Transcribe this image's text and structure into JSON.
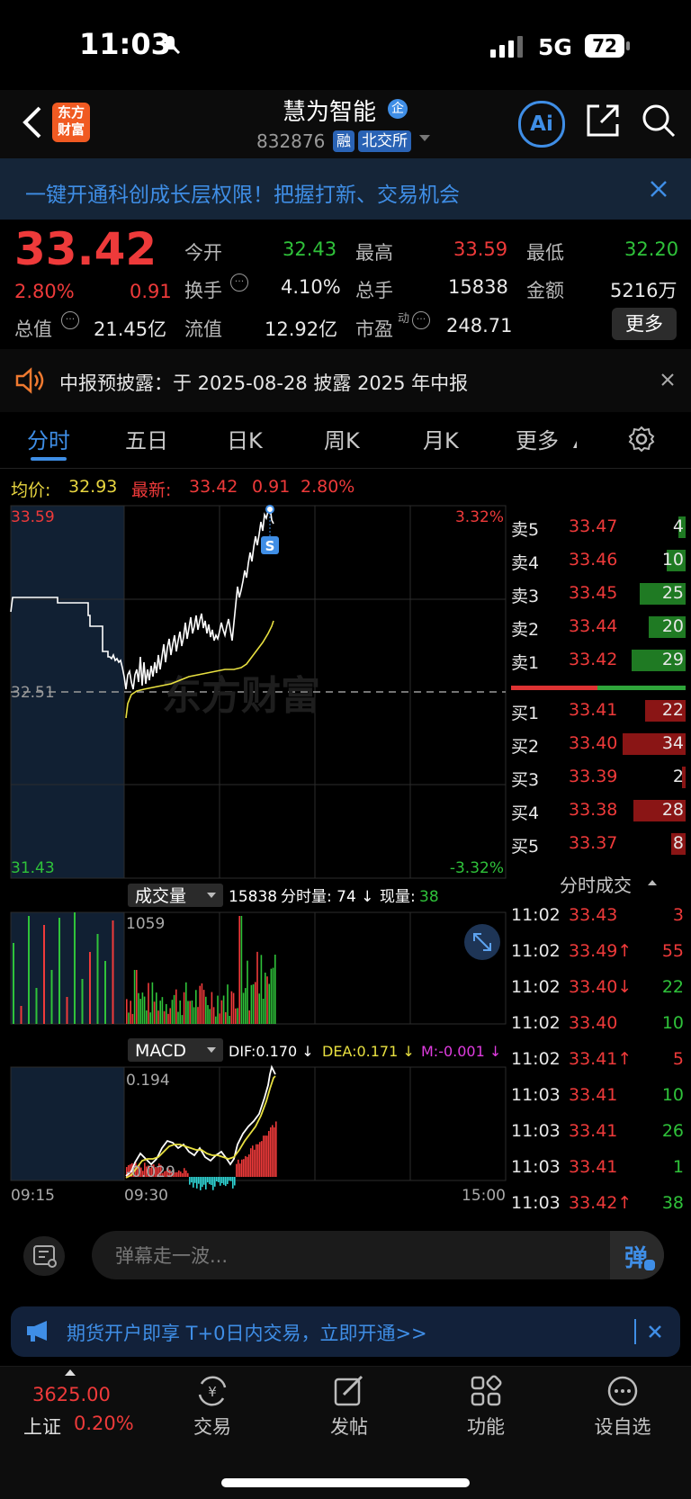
{
  "status_bar": {
    "time": "11:03",
    "network": "5G",
    "battery": "72"
  },
  "header": {
    "brand_logo": "东方\n财富",
    "stock_name": "慧为智能",
    "badge_qi": "企",
    "stock_code": "832876",
    "tag_rong": "融",
    "tag_exchange": "北交所",
    "ai_label": "Ai"
  },
  "banner": {
    "text": "一键开通科创成长层权限！把握打新、交易机会"
  },
  "quote": {
    "price": "33.42",
    "change_pct": "2.80%",
    "change": "0.91",
    "open_label": "今开",
    "open": "32.43",
    "high_label": "最高",
    "high": "33.59",
    "low_label": "最低",
    "low": "32.20",
    "turnover_label": "换手",
    "turnover": "4.10%",
    "volume_label": "总手",
    "volume": "15838",
    "amount_label": "金额",
    "amount": "5216万",
    "mktcap_label": "总值",
    "mktcap": "21.45亿",
    "float_label": "流值",
    "float": "12.92亿",
    "pe_label": "市盈",
    "pe_sup": "动",
    "pe": "248.71",
    "more": "更多"
  },
  "notice": {
    "text": "中报预披露：于 2025-08-28 披露 2025 年中报"
  },
  "tabs": [
    "分时",
    "五日",
    "日K",
    "周K",
    "月K",
    "更多"
  ],
  "chart_header": {
    "avg_label": "均价:",
    "avg": "32.93",
    "latest_label": "最新:",
    "latest": "33.42",
    "latest_change": "0.91",
    "latest_pct": "2.80%"
  },
  "price_chart": {
    "y_top": "33.59",
    "y_mid": "32.51",
    "y_bottom": "31.43",
    "pct_top": "3.32%",
    "pct_bottom": "-3.32%",
    "marker": "S",
    "watermark": "东方财富"
  },
  "volume_panel": {
    "label": "成交量",
    "total": "15838",
    "minute_label": "分时量: 74 ↓",
    "now_label": "现量:",
    "now": "38",
    "ytick": "1059"
  },
  "macd_panel": {
    "label": "MACD",
    "dif": "DIF:0.170 ↓",
    "dea": "DEA:0.171 ↓",
    "m": "M:-0.001 ↓",
    "ytop": "0.194",
    "ybottom": "-0.029"
  },
  "x_axis": {
    "start": "09:15",
    "open": "09:30",
    "end": "15:00"
  },
  "order_book": {
    "asks": [
      {
        "label": "卖5",
        "price": "33.47",
        "qty": "4"
      },
      {
        "label": "卖4",
        "price": "33.46",
        "qty": "10"
      },
      {
        "label": "卖3",
        "price": "33.45",
        "qty": "25"
      },
      {
        "label": "卖2",
        "price": "33.44",
        "qty": "20"
      },
      {
        "label": "卖1",
        "price": "33.42",
        "qty": "29"
      }
    ],
    "bids": [
      {
        "label": "买1",
        "price": "33.41",
        "qty": "22"
      },
      {
        "label": "买2",
        "price": "33.40",
        "qty": "34"
      },
      {
        "label": "买3",
        "price": "33.39",
        "qty": "2"
      },
      {
        "label": "买4",
        "price": "33.38",
        "qty": "28"
      },
      {
        "label": "买5",
        "price": "33.37",
        "qty": "8"
      }
    ]
  },
  "ticks_title": "分时成交",
  "ticks": [
    {
      "time": "11:02",
      "price": "33.43",
      "qty": "3",
      "qcolor": "red"
    },
    {
      "time": "11:02",
      "price": "33.49↑",
      "qty": "55",
      "qcolor": "red"
    },
    {
      "time": "11:02",
      "price": "33.40↓",
      "qty": "22",
      "qcolor": "green"
    },
    {
      "time": "11:02",
      "price": "33.40",
      "qty": "10",
      "qcolor": "green"
    },
    {
      "time": "11:02",
      "price": "33.41↑",
      "qty": "5",
      "qcolor": "red"
    },
    {
      "time": "11:03",
      "price": "33.41",
      "qty": "10",
      "qcolor": "green"
    },
    {
      "time": "11:03",
      "price": "33.41",
      "qty": "26",
      "qcolor": "green"
    },
    {
      "time": "11:03",
      "price": "33.41",
      "qty": "1",
      "qcolor": "green"
    },
    {
      "time": "11:03",
      "price": "33.42↑",
      "qty": "38",
      "qcolor": "green"
    }
  ],
  "danmu": {
    "placeholder": "弹幕走一波...",
    "send": "弹"
  },
  "promo": {
    "text": "期货开户即享 T+0日内交易，立即开通>>"
  },
  "tabbar": {
    "index_value": "3625.00",
    "index_name": "上证",
    "index_pct": "0.20%",
    "items": [
      "交易",
      "发帖",
      "功能",
      "设自选"
    ]
  },
  "colors": {
    "up": "#ee3a3a",
    "down": "#2fc23a",
    "avg_line": "#e8e040",
    "accent": "#3f8ee6"
  }
}
